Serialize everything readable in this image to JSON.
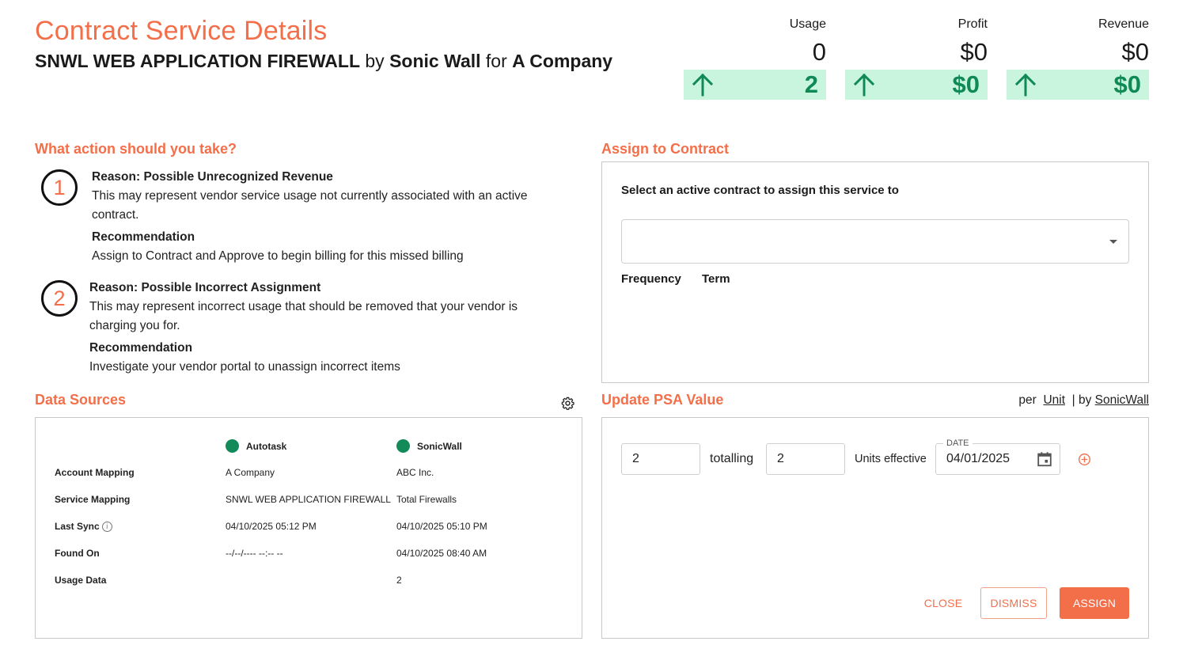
{
  "header": {
    "title": "Contract Service Details",
    "service_name": "SNWL WEB APPLICATION FIREWALL",
    "by_word": "by",
    "vendor": "Sonic Wall",
    "for_word": "for",
    "company": "A Company"
  },
  "metrics": [
    {
      "label": "Usage",
      "value": "0",
      "delta": "2"
    },
    {
      "label": "Profit",
      "value": "$0",
      "delta": "$0"
    },
    {
      "label": "Revenue",
      "value": "$0",
      "delta": "$0"
    }
  ],
  "actions": {
    "heading": "What action should you take?",
    "reasons": [
      {
        "number": "1",
        "title": "Reason: Possible Unrecognized Revenue",
        "description": "This may represent vendor service usage not currently associated with an active contract.",
        "rec_label": "Recommendation",
        "recommendation": "Assign to Contract and Approve to begin billing for this missed billing"
      },
      {
        "number": "2",
        "title": "Reason: Possible Incorrect Assignment",
        "description": "This may represent incorrect usage that should be removed that your vendor is charging you for.",
        "rec_label": "Recommendation",
        "recommendation": "Investigate your vendor portal to unassign incorrect items"
      }
    ]
  },
  "data_sources": {
    "heading": "Data Sources",
    "columns": [
      "Autotask",
      "SonicWall"
    ],
    "rows": [
      {
        "label": "Account Mapping",
        "a": "A Company",
        "b": "ABC Inc."
      },
      {
        "label": "Service Mapping",
        "a": "SNWL WEB APPLICATION FIREWALL",
        "b": "Total Firewalls"
      },
      {
        "label": "Last Sync",
        "a": "04/10/2025 05:12 PM",
        "b": "04/10/2025 05:10 PM"
      },
      {
        "label": "Found On",
        "a": "--/--/---- --:-- --",
        "b": "04/10/2025 08:40 AM"
      },
      {
        "label": "Usage Data",
        "a": "",
        "b": "2"
      }
    ],
    "status_color": "#138a5a"
  },
  "assign": {
    "heading": "Assign to Contract",
    "instruction": "Select an active contract to assign this service to",
    "selected_contract": "",
    "frequency_label": "Frequency",
    "term_label": "Term"
  },
  "psa": {
    "heading": "Update PSA Value",
    "per_word": "per",
    "unit_link": "Unit",
    "by_word": "| by",
    "vendor_link": "SonicWall",
    "quantity": "2",
    "totalling_label": "totalling",
    "total": "2",
    "units_effective_label": "Units effective",
    "date_label": "DATE",
    "date": "04/01/2025"
  },
  "buttons": {
    "close": "CLOSE",
    "dismiss": "DISMISS",
    "assign": "ASSIGN"
  },
  "colors": {
    "accent": "#f36f4a",
    "positive": "#0f8a55",
    "positive_bg": "#c9f5df"
  }
}
